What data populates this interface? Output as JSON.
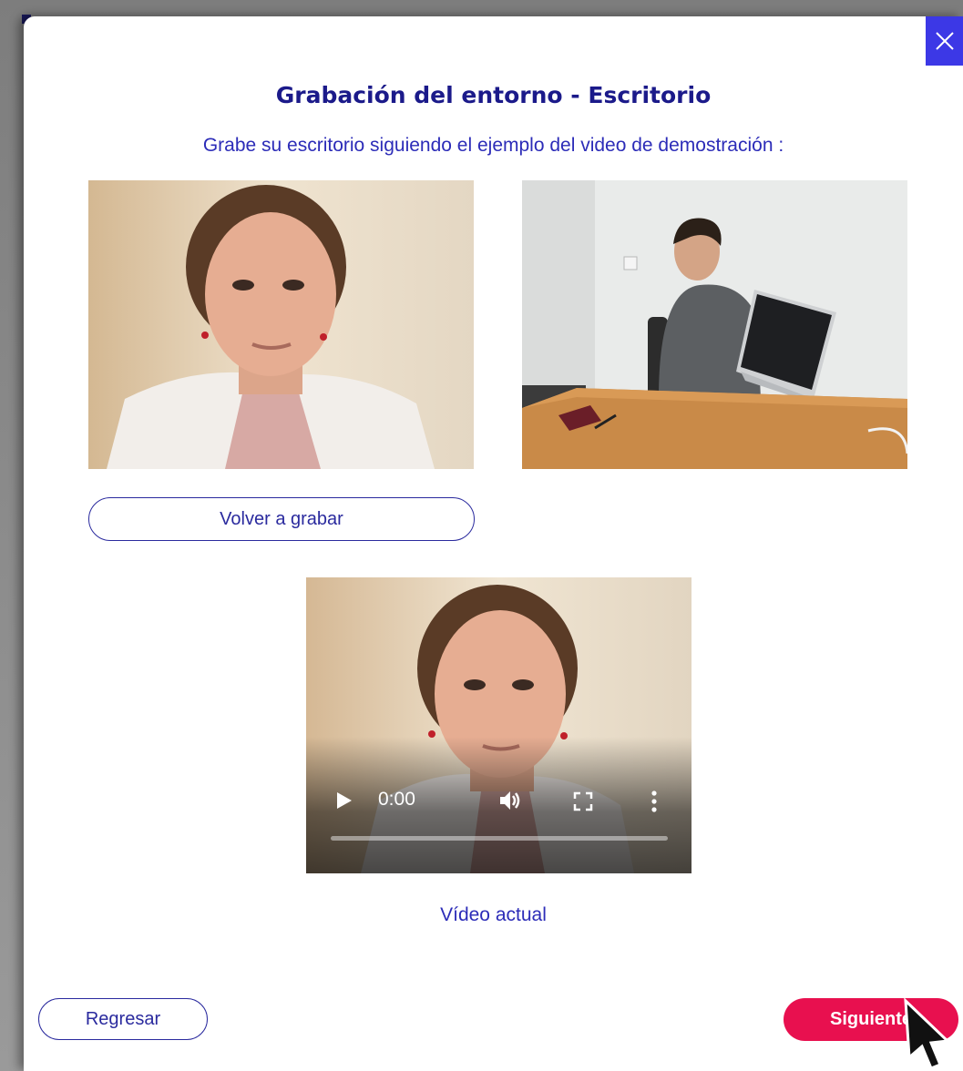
{
  "modal": {
    "title": "Grabación del entorno - Escritorio",
    "subtitle": "Grabe su escritorio siguiendo el ejemplo del video de demostración :",
    "close_icon": "close-icon"
  },
  "videos": {
    "user_recording": "user-recording-image",
    "demo_example": "demo-video-image",
    "current": "current-video-image"
  },
  "rerecord_button": "Volver a grabar",
  "player": {
    "time": "0:00",
    "progress": 0,
    "play_icon": "play-icon",
    "volume_icon": "volume-icon",
    "fullscreen_icon": "fullscreen-icon",
    "more_icon": "more-options-icon"
  },
  "current_caption": "Vídeo actual",
  "footer": {
    "back_label": "Regresar",
    "next_label": "Siguiente"
  },
  "colors": {
    "primary": "#1b1a8a",
    "accent": "#3c38e6",
    "next_button": "#e8104f"
  }
}
